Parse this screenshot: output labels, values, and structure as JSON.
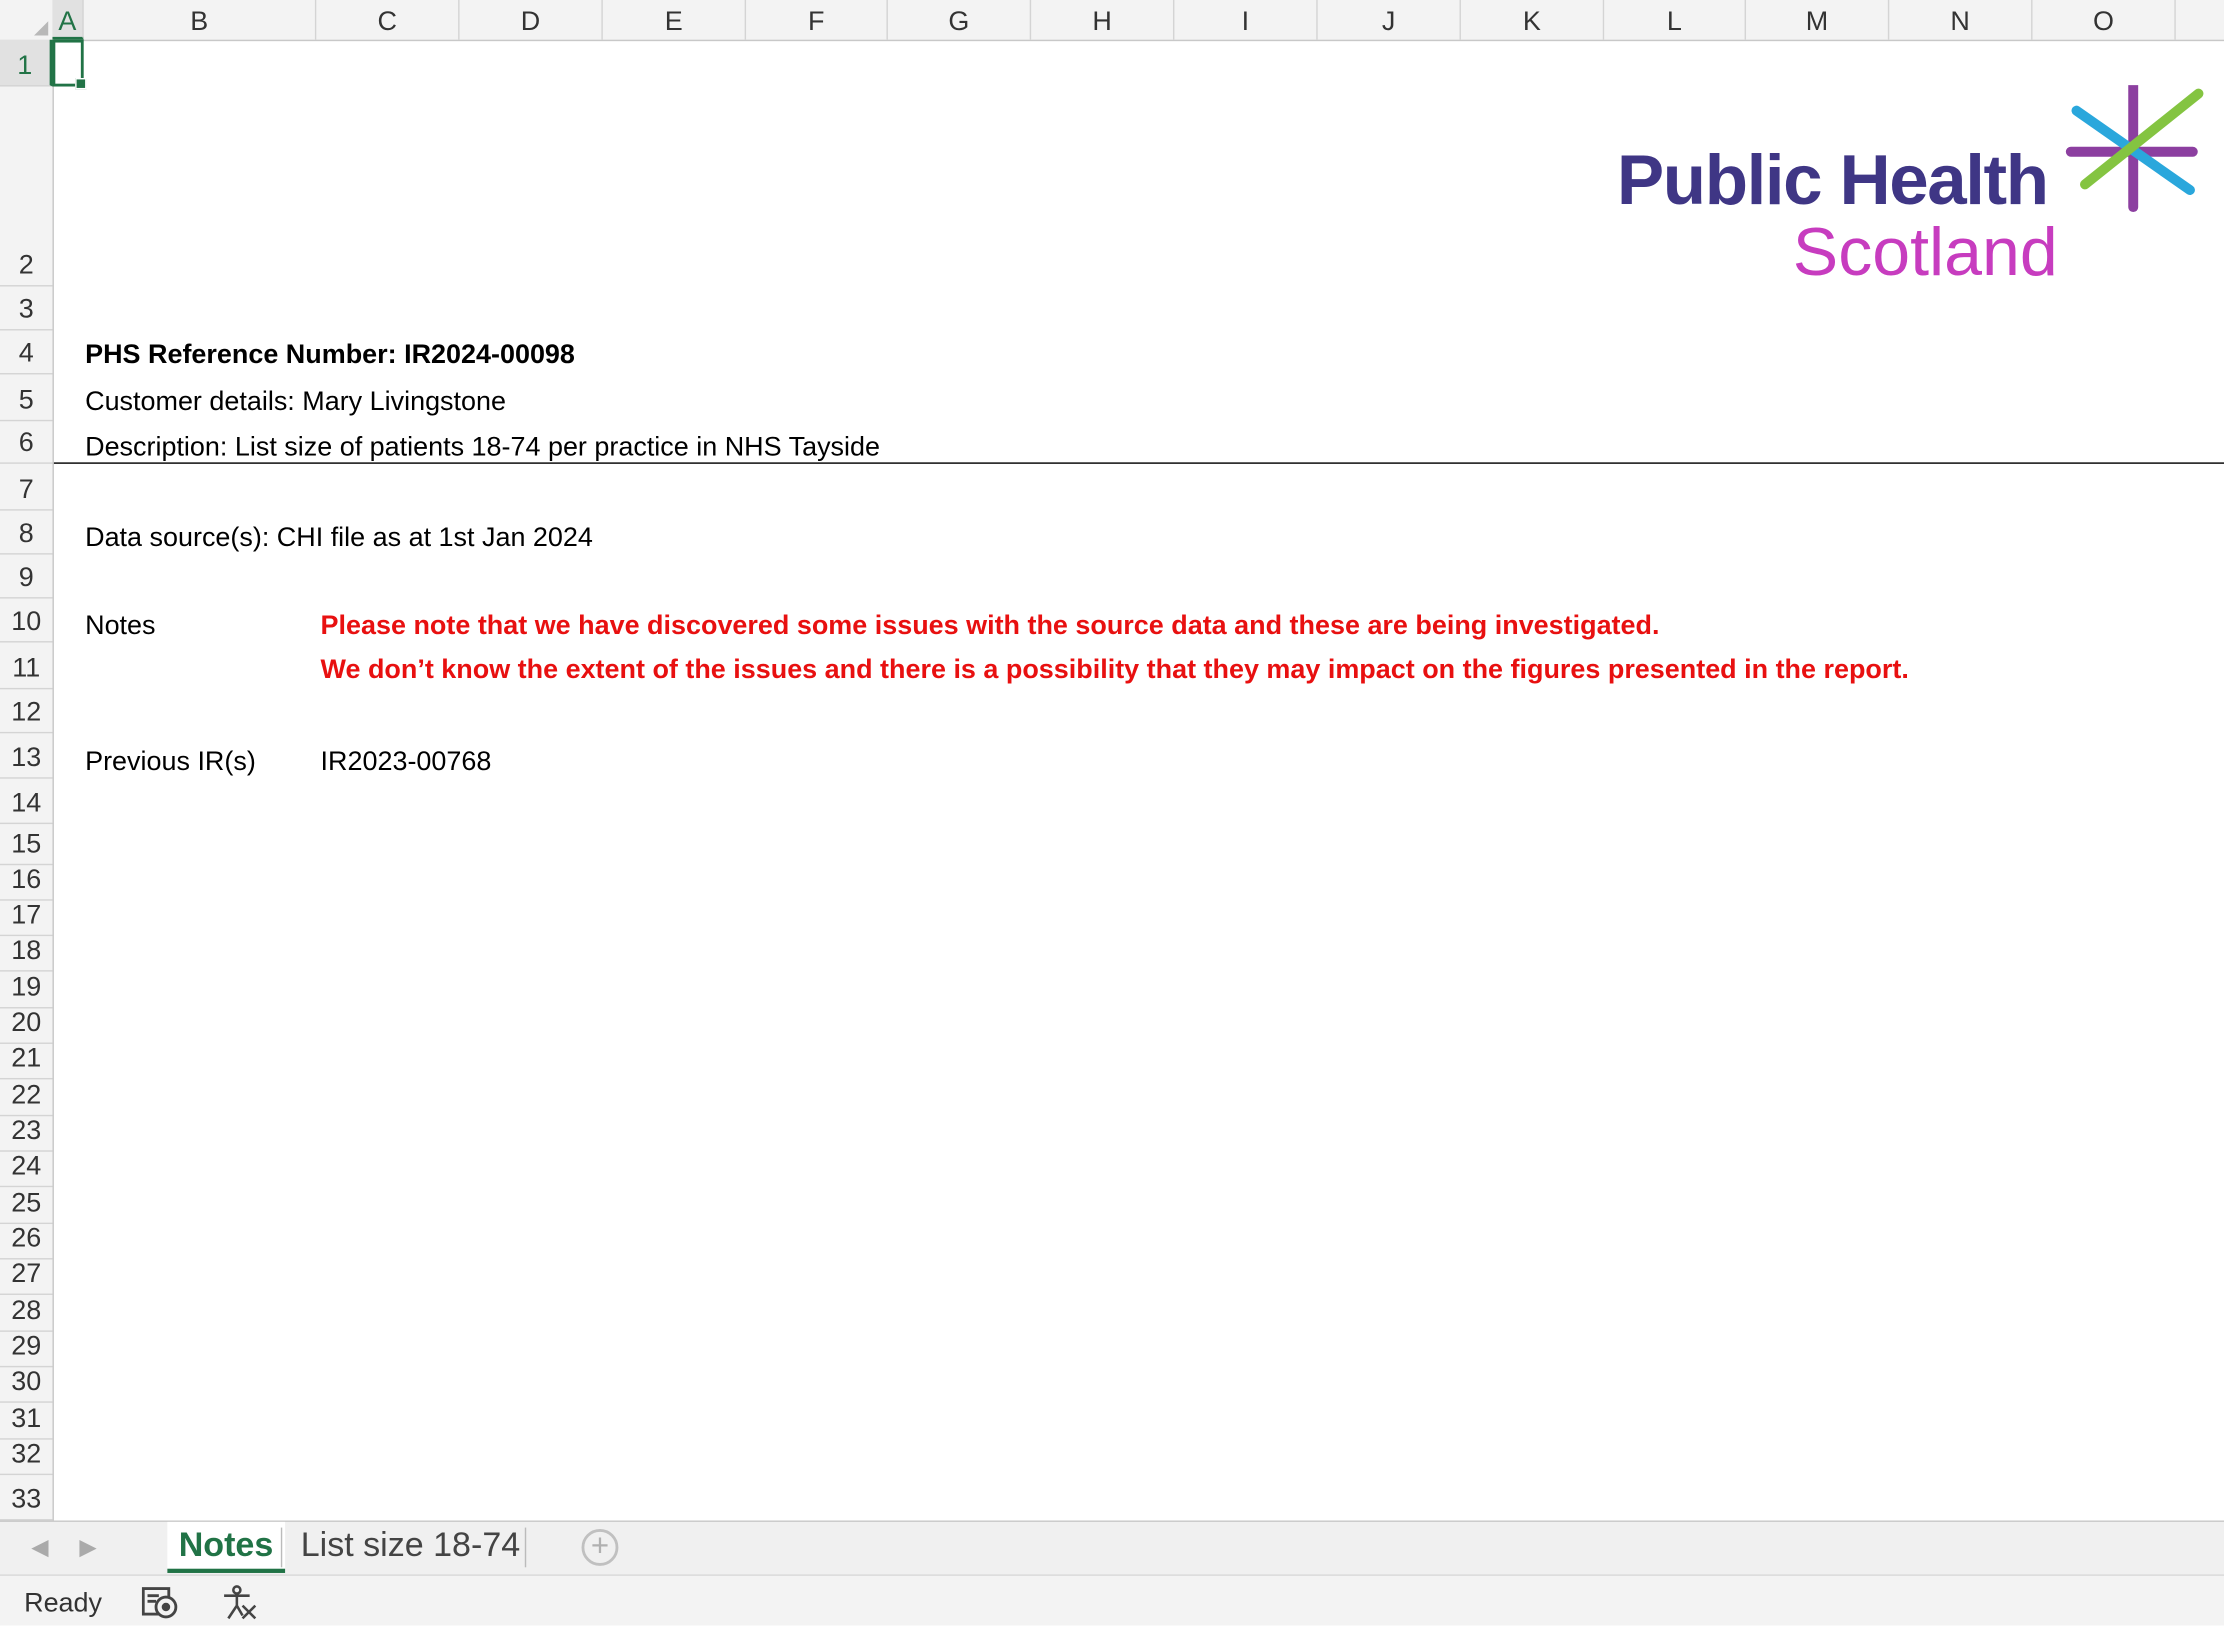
{
  "columns": [
    "A",
    "B",
    "C",
    "D",
    "E",
    "F",
    "G",
    "H",
    "I",
    "J",
    "K",
    "L",
    "M",
    "N",
    "O"
  ],
  "rows": [
    "1",
    "2",
    "3",
    "4",
    "5",
    "6",
    "7",
    "8",
    "9",
    "10",
    "11",
    "12",
    "13",
    "14",
    "15",
    "16",
    "17",
    "18",
    "19",
    "20",
    "21",
    "22",
    "23",
    "24",
    "25",
    "26",
    "27",
    "28",
    "29",
    "30",
    "31",
    "32",
    "33"
  ],
  "logo": {
    "line1": "Public Health",
    "line2": "Scotland",
    "colors": {
      "navy": "#3f3685",
      "magenta": "#c73cbf",
      "blue": "#2aa7dc",
      "green": "#84c441",
      "purple": "#8c3fa0"
    }
  },
  "cells": {
    "ref": "PHS Reference Number: IR2024-00098",
    "customer": "Customer details: Mary Livingstone",
    "description": "Description:  List size of patients 18-74 per practice in NHS Tayside",
    "source": "Data source(s): CHI file as at 1st Jan 2024",
    "notes_label": "Notes",
    "note1": "Please note that we have discovered some issues with the source data and these are being investigated.",
    "note2": "We don’t know the extent of the issues and there is a possibility that they may impact on the figures presented in the report.",
    "prev_label": "Previous IR(s)",
    "prev_value": "IR2023-00768"
  },
  "tabs": {
    "active": "Notes",
    "other": "List size 18-74"
  },
  "status": {
    "ready": "Ready"
  },
  "colors": {
    "excel_green": "#217346",
    "note_red": "#e81010"
  }
}
